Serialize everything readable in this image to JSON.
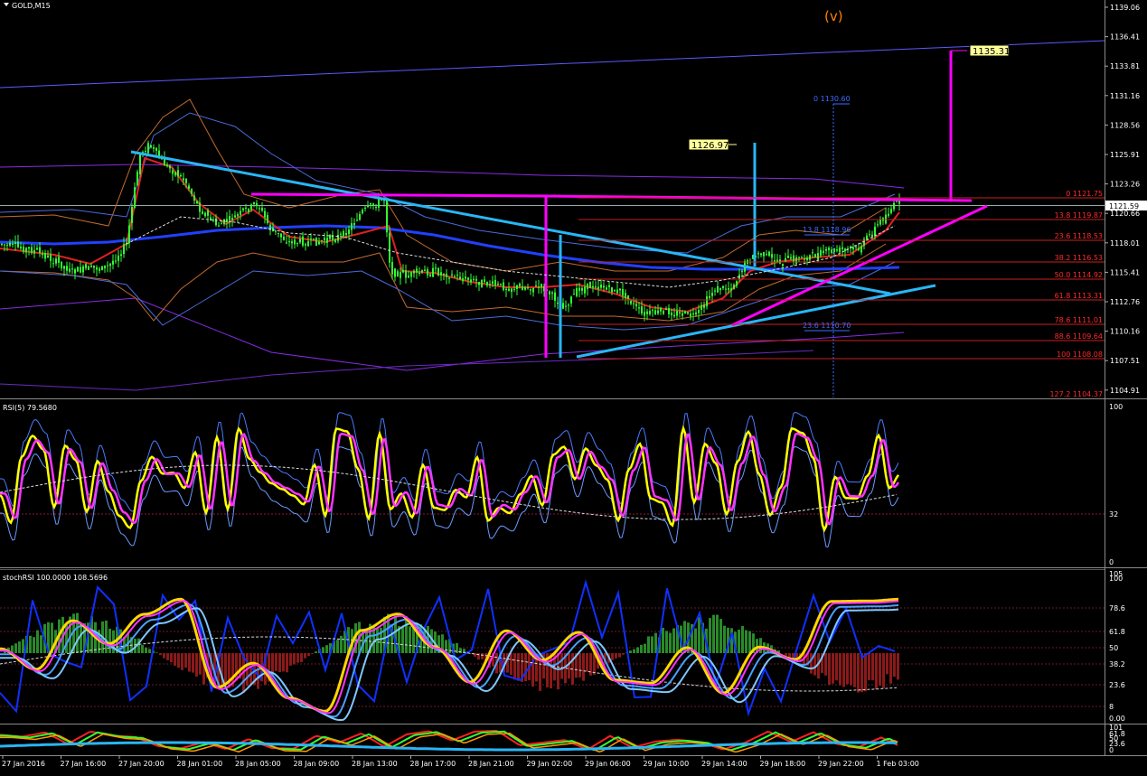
{
  "window": {
    "title": "GOLD,M15"
  },
  "colors": {
    "background": "#000000",
    "candle": "#33ff33",
    "trend_cyan": "#29b6f6",
    "magenta": "#ff00ff",
    "fib": "#ff2a2a",
    "blue_band": "#3b6bff",
    "rsi_yellow": "#ffff00"
  },
  "main_panel": {
    "price_labels": [
      "1139.06",
      "1136.41",
      "1133.81",
      "1131.16",
      "1128.56",
      "1125.91",
      "1123.26",
      "1120.66",
      "1118.01",
      "1115.41",
      "1112.76",
      "1110.16",
      "1107.51",
      "1104.91"
    ],
    "current_price": "1121.59",
    "wave_label": "(v)",
    "target_box": "1135.31",
    "box_1126": "1126.97",
    "fib_top": "0 1130.60",
    "fib_mid": "13.8 1118.96",
    "fib_low": "23.6 1110.70",
    "fib_levels": [
      "0 1121.75",
      "13.8 1119.87",
      "23.6 1118.53",
      "38.2 1116.53",
      "50.0 1114.92",
      "61.8 1113.31",
      "78.6 1111.01",
      "88.6 1109.64",
      "100 1108.08",
      "127.2 1104.37"
    ]
  },
  "rsi_panel": {
    "title": "RSI(5) 79.5680",
    "scale": [
      "100",
      "32",
      "0"
    ]
  },
  "stoch_panel": {
    "title": "stochRSI 100.0000 108.5696",
    "scale": [
      "105",
      "100",
      "78.6",
      "61.8",
      "50",
      "38.2",
      "23.6",
      "8",
      "0.00"
    ]
  },
  "mini_panel": {
    "scale": [
      "101",
      "61.8",
      "50",
      "23.6",
      "0"
    ]
  },
  "time_axis": [
    "27 Jan 2016",
    "27 Jan 16:00",
    "27 Jan 20:00",
    "28 Jan 01:00",
    "28 Jan 05:00",
    "28 Jan 09:00",
    "28 Jan 13:00",
    "28 Jan 17:00",
    "28 Jan 21:00",
    "29 Jan 02:00",
    "29 Jan 06:00",
    "29 Jan 10:00",
    "29 Jan 14:00",
    "29 Jan 18:00",
    "29 Jan 22:00",
    "1 Feb 03:00"
  ]
}
